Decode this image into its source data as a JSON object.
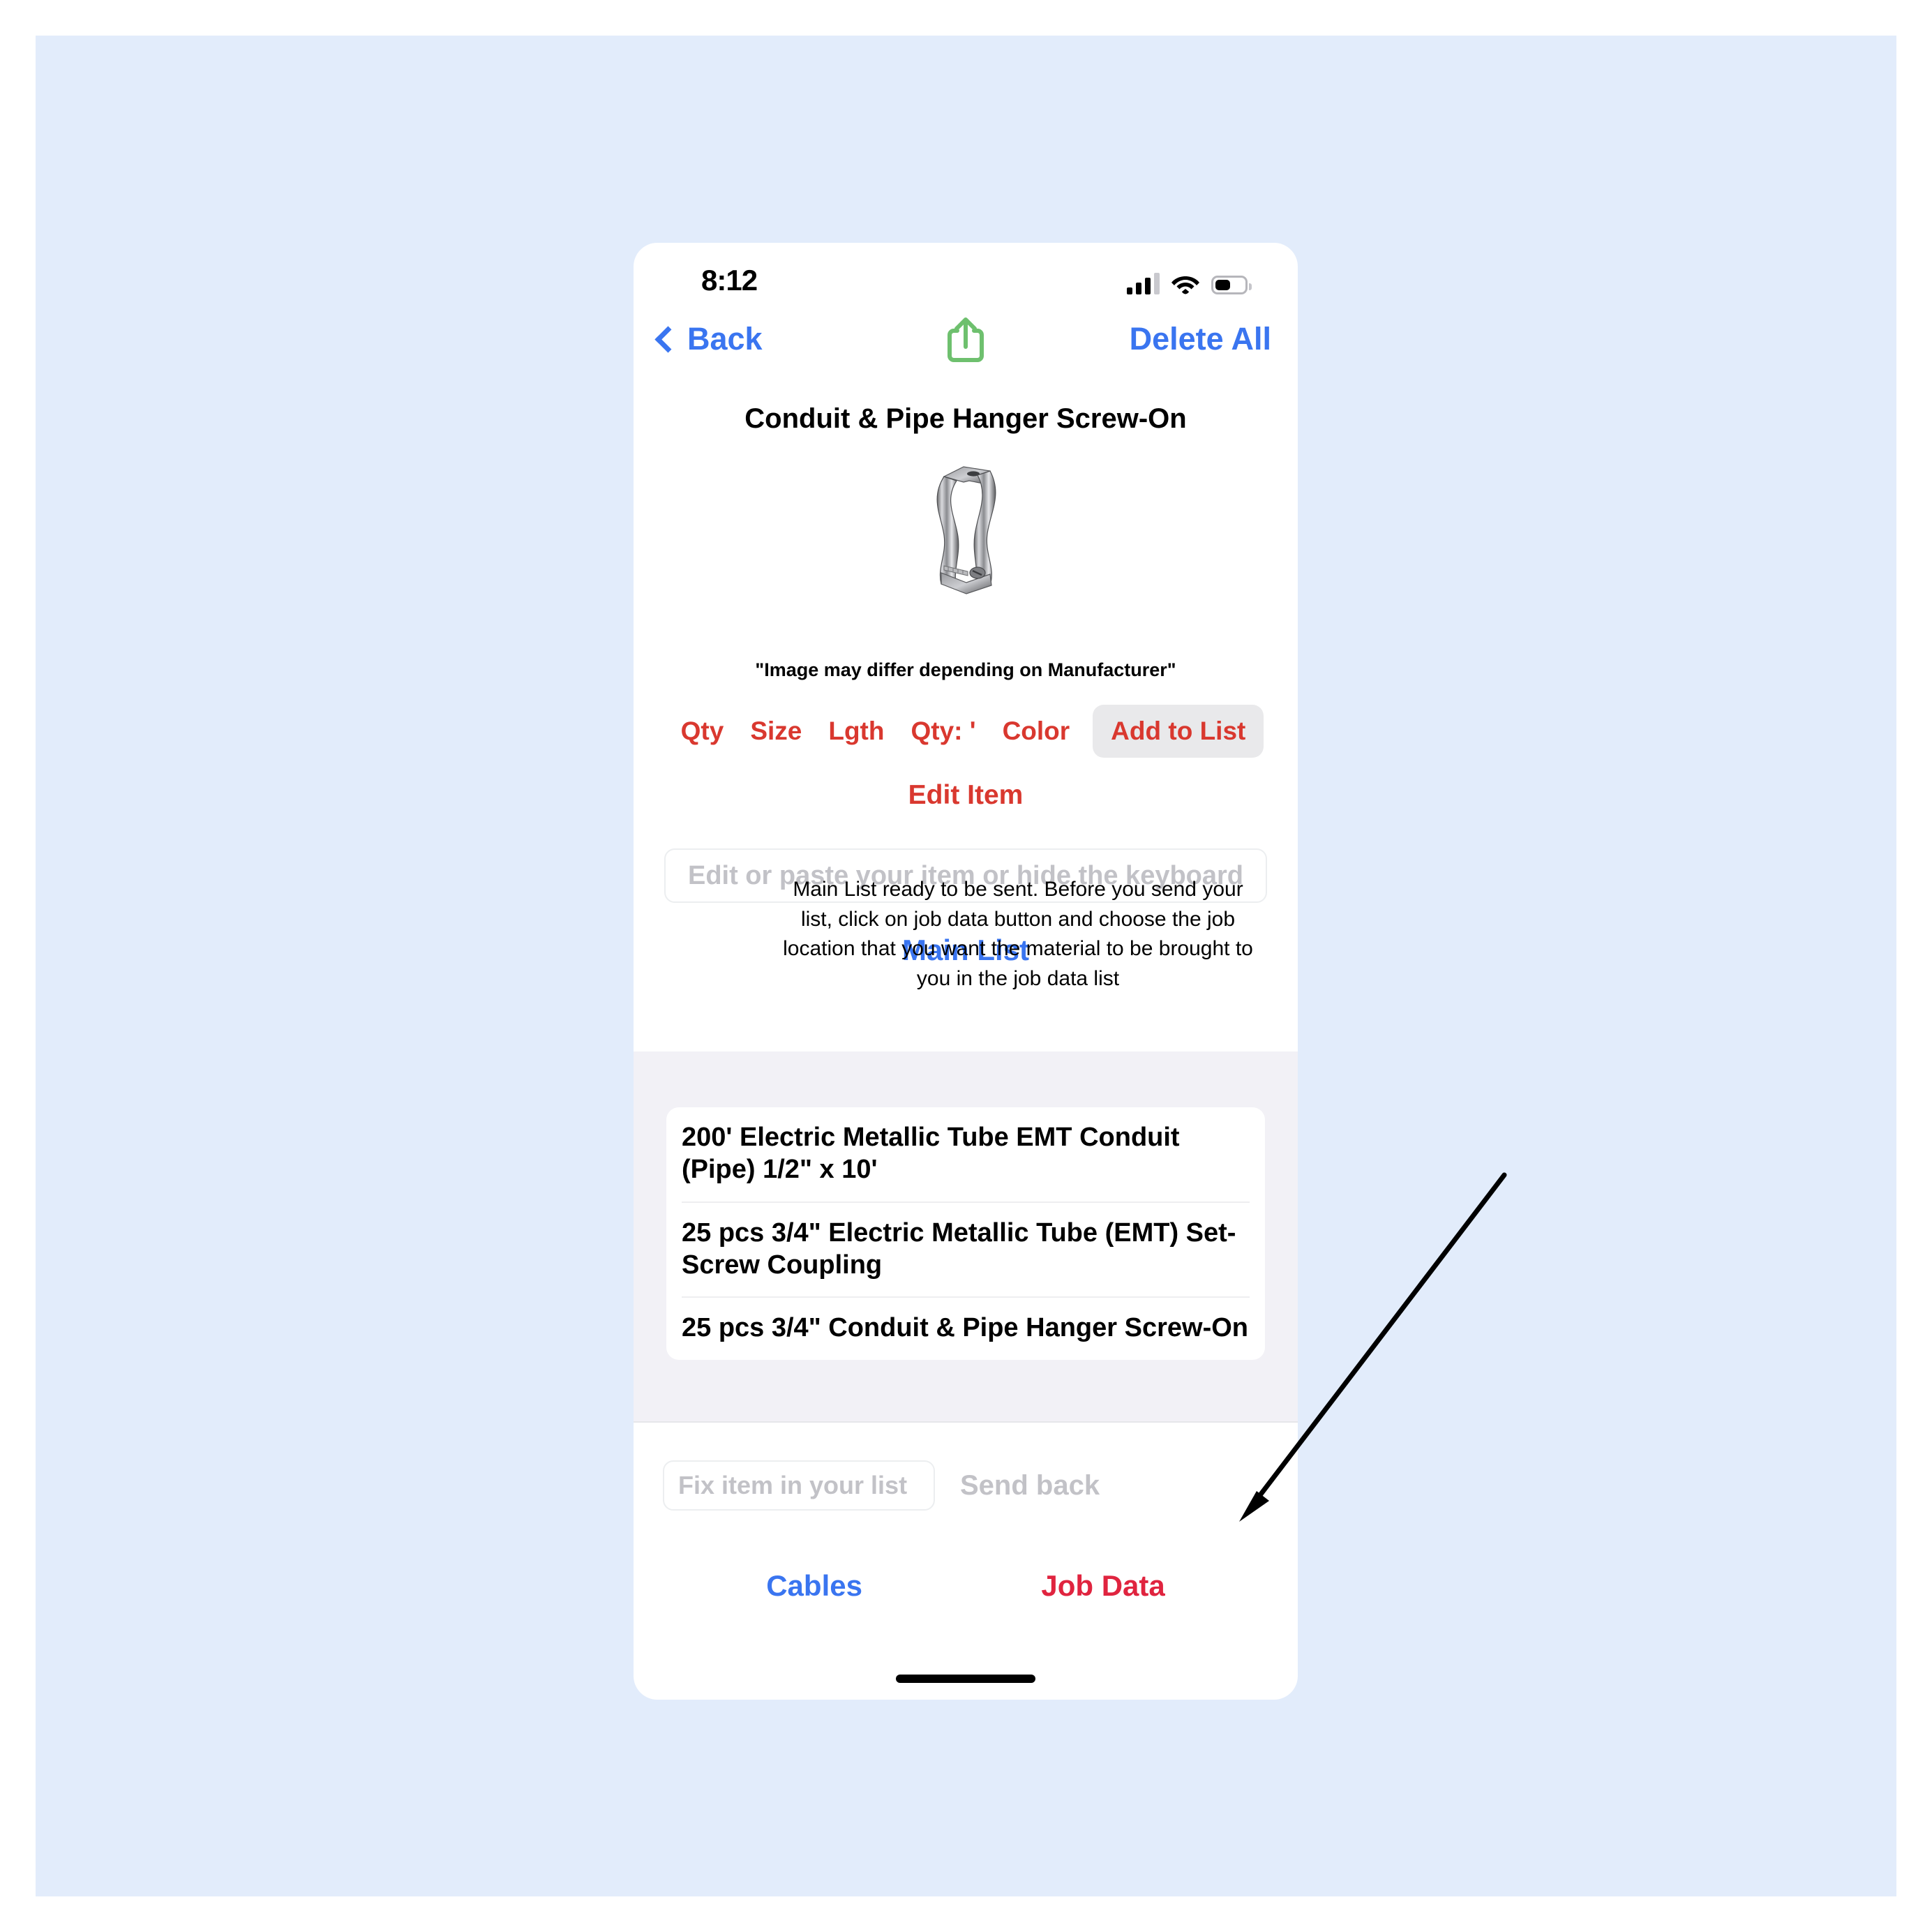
{
  "canvas": {
    "background": "#e2ecfb"
  },
  "status_bar": {
    "time": "8:12",
    "icons": [
      "cellular-signal-icon",
      "wifi-icon",
      "battery-icon"
    ],
    "battery_level": "46%"
  },
  "nav_bar": {
    "back_label": "Back",
    "share_icon": "share-icon",
    "share_color": "#6ec06e",
    "delete_all_label": "Delete All",
    "accent": "#3a75f0"
  },
  "product": {
    "title": "Conduit & Pipe Hanger Screw-On",
    "image_icon": "conduit-pipe-hanger-clamp-image",
    "disclaimer": "\"Image may differ depending on Manufacturer\""
  },
  "options": {
    "accent": "#d9382f",
    "buttons": [
      {
        "label": "Qty"
      },
      {
        "label": "Size"
      },
      {
        "label": "Lgth"
      },
      {
        "label": "Qty: '"
      },
      {
        "label": "Color"
      }
    ],
    "add_to_list_label": "Add to List",
    "edit_item_label": "Edit Item"
  },
  "edit_field": {
    "value": "",
    "placeholder": "Edit or paste your item or hide the keyboard"
  },
  "main_list_label": "Main List",
  "list": {
    "items": [
      {
        "text": " 200'   Electric Metallic Tube EMT Conduit (Pipe) 1/2\" x 10'"
      },
      {
        "text": "25 pcs  3/4\"   Electric Metallic Tube (EMT) Set-Screw Coupling"
      },
      {
        "text": "25 pcs  3/4\"   Conduit & Pipe Hanger Screw-On"
      }
    ]
  },
  "bottom_bar": {
    "fix_field_value": "",
    "fix_field_placeholder": "Fix item in your list",
    "send_back_label": "Send back"
  },
  "tab_bar": {
    "cables_label": "Cables",
    "cables_color": "#3a75f0",
    "job_data_label": "Job Data",
    "job_data_color": "#e0243f"
  },
  "annotation": {
    "text": "Main List ready to be sent. Before you send your list, click on job data button and choose the job location that you want the material to be brought to you in the job data list",
    "arrow": "annotation-arrow"
  }
}
